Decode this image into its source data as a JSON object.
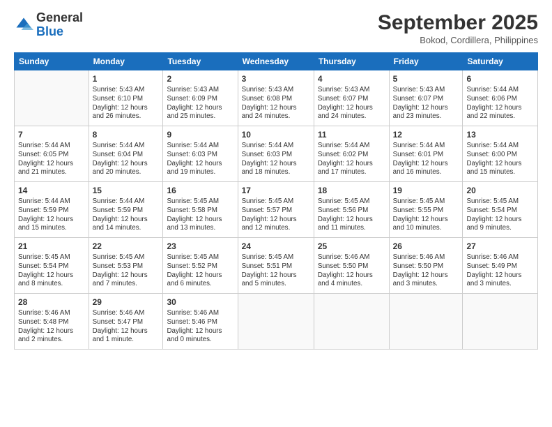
{
  "logo": {
    "general": "General",
    "blue": "Blue"
  },
  "header": {
    "title": "September 2025",
    "location": "Bokod, Cordillera, Philippines"
  },
  "days": [
    "Sunday",
    "Monday",
    "Tuesday",
    "Wednesday",
    "Thursday",
    "Friday",
    "Saturday"
  ],
  "weeks": [
    [
      {
        "day": "",
        "content": ""
      },
      {
        "day": "1",
        "content": "Sunrise: 5:43 AM\nSunset: 6:10 PM\nDaylight: 12 hours\nand 26 minutes."
      },
      {
        "day": "2",
        "content": "Sunrise: 5:43 AM\nSunset: 6:09 PM\nDaylight: 12 hours\nand 25 minutes."
      },
      {
        "day": "3",
        "content": "Sunrise: 5:43 AM\nSunset: 6:08 PM\nDaylight: 12 hours\nand 24 minutes."
      },
      {
        "day": "4",
        "content": "Sunrise: 5:43 AM\nSunset: 6:07 PM\nDaylight: 12 hours\nand 24 minutes."
      },
      {
        "day": "5",
        "content": "Sunrise: 5:43 AM\nSunset: 6:07 PM\nDaylight: 12 hours\nand 23 minutes."
      },
      {
        "day": "6",
        "content": "Sunrise: 5:44 AM\nSunset: 6:06 PM\nDaylight: 12 hours\nand 22 minutes."
      }
    ],
    [
      {
        "day": "7",
        "content": "Sunrise: 5:44 AM\nSunset: 6:05 PM\nDaylight: 12 hours\nand 21 minutes."
      },
      {
        "day": "8",
        "content": "Sunrise: 5:44 AM\nSunset: 6:04 PM\nDaylight: 12 hours\nand 20 minutes."
      },
      {
        "day": "9",
        "content": "Sunrise: 5:44 AM\nSunset: 6:03 PM\nDaylight: 12 hours\nand 19 minutes."
      },
      {
        "day": "10",
        "content": "Sunrise: 5:44 AM\nSunset: 6:03 PM\nDaylight: 12 hours\nand 18 minutes."
      },
      {
        "day": "11",
        "content": "Sunrise: 5:44 AM\nSunset: 6:02 PM\nDaylight: 12 hours\nand 17 minutes."
      },
      {
        "day": "12",
        "content": "Sunrise: 5:44 AM\nSunset: 6:01 PM\nDaylight: 12 hours\nand 16 minutes."
      },
      {
        "day": "13",
        "content": "Sunrise: 5:44 AM\nSunset: 6:00 PM\nDaylight: 12 hours\nand 15 minutes."
      }
    ],
    [
      {
        "day": "14",
        "content": "Sunrise: 5:44 AM\nSunset: 5:59 PM\nDaylight: 12 hours\nand 15 minutes."
      },
      {
        "day": "15",
        "content": "Sunrise: 5:44 AM\nSunset: 5:59 PM\nDaylight: 12 hours\nand 14 minutes."
      },
      {
        "day": "16",
        "content": "Sunrise: 5:45 AM\nSunset: 5:58 PM\nDaylight: 12 hours\nand 13 minutes."
      },
      {
        "day": "17",
        "content": "Sunrise: 5:45 AM\nSunset: 5:57 PM\nDaylight: 12 hours\nand 12 minutes."
      },
      {
        "day": "18",
        "content": "Sunrise: 5:45 AM\nSunset: 5:56 PM\nDaylight: 12 hours\nand 11 minutes."
      },
      {
        "day": "19",
        "content": "Sunrise: 5:45 AM\nSunset: 5:55 PM\nDaylight: 12 hours\nand 10 minutes."
      },
      {
        "day": "20",
        "content": "Sunrise: 5:45 AM\nSunset: 5:54 PM\nDaylight: 12 hours\nand 9 minutes."
      }
    ],
    [
      {
        "day": "21",
        "content": "Sunrise: 5:45 AM\nSunset: 5:54 PM\nDaylight: 12 hours\nand 8 minutes."
      },
      {
        "day": "22",
        "content": "Sunrise: 5:45 AM\nSunset: 5:53 PM\nDaylight: 12 hours\nand 7 minutes."
      },
      {
        "day": "23",
        "content": "Sunrise: 5:45 AM\nSunset: 5:52 PM\nDaylight: 12 hours\nand 6 minutes."
      },
      {
        "day": "24",
        "content": "Sunrise: 5:45 AM\nSunset: 5:51 PM\nDaylight: 12 hours\nand 5 minutes."
      },
      {
        "day": "25",
        "content": "Sunrise: 5:46 AM\nSunset: 5:50 PM\nDaylight: 12 hours\nand 4 minutes."
      },
      {
        "day": "26",
        "content": "Sunrise: 5:46 AM\nSunset: 5:50 PM\nDaylight: 12 hours\nand 3 minutes."
      },
      {
        "day": "27",
        "content": "Sunrise: 5:46 AM\nSunset: 5:49 PM\nDaylight: 12 hours\nand 3 minutes."
      }
    ],
    [
      {
        "day": "28",
        "content": "Sunrise: 5:46 AM\nSunset: 5:48 PM\nDaylight: 12 hours\nand 2 minutes."
      },
      {
        "day": "29",
        "content": "Sunrise: 5:46 AM\nSunset: 5:47 PM\nDaylight: 12 hours\nand 1 minute."
      },
      {
        "day": "30",
        "content": "Sunrise: 5:46 AM\nSunset: 5:46 PM\nDaylight: 12 hours\nand 0 minutes."
      },
      {
        "day": "",
        "content": ""
      },
      {
        "day": "",
        "content": ""
      },
      {
        "day": "",
        "content": ""
      },
      {
        "day": "",
        "content": ""
      }
    ]
  ]
}
